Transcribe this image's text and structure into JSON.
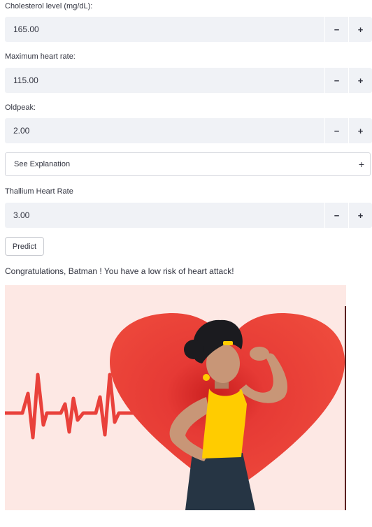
{
  "fields": [
    {
      "label": "Cholesterol level (mg/dL):",
      "value": "165.00"
    },
    {
      "label": "Maximum heart rate:",
      "value": "115.00"
    },
    {
      "label": "Oldpeak:",
      "value": "2.00"
    },
    {
      "label": "Thallium Heart Rate",
      "value": "3.00"
    }
  ],
  "stepper": {
    "minus": "−",
    "plus": "+"
  },
  "expander": {
    "label": "See Explanation",
    "icon": "+"
  },
  "predict_label": "Predict",
  "result_message": "Congratulations, Batman ! You have a low risk of heart attack!",
  "colors": {
    "input_bg": "#f0f2f6",
    "heart": "#e9413b",
    "illustration_bg": "#fde8e4",
    "top": "#ffcc00",
    "skin": "#c89677"
  }
}
